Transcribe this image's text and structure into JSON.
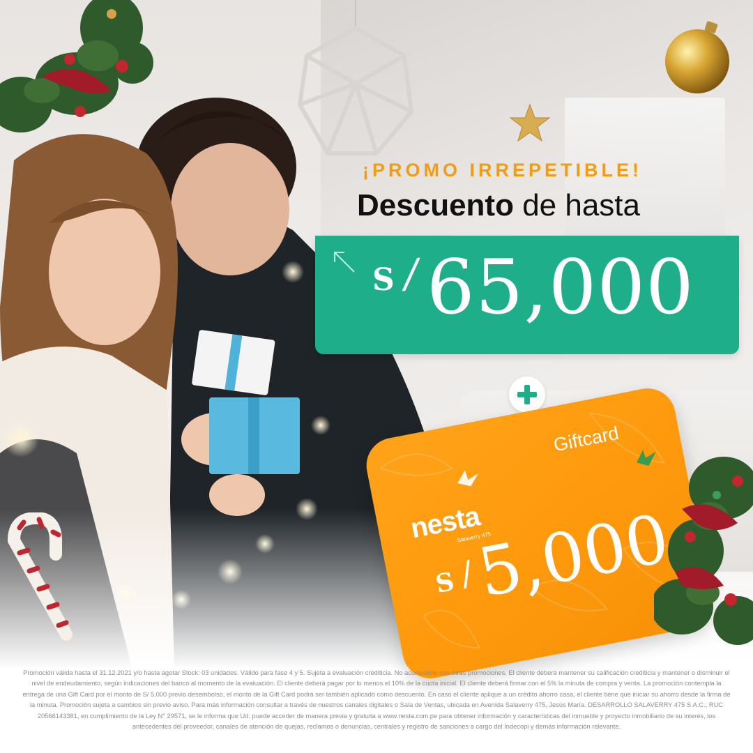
{
  "promo": {
    "kicker": "¡PROMO IRREPETIBLE!",
    "headline_strong": "Descuento",
    "headline_light": "de hasta"
  },
  "discount": {
    "currency": "S",
    "slash": "/",
    "amount": "65,000",
    "panel_color": "#1fae8a"
  },
  "plus_icon": "plus-icon",
  "giftcard": {
    "label": "Giftcard",
    "brand": "nesta",
    "brand_sub": "Salaverry 475",
    "currency": "S",
    "slash": "/",
    "amount": "5,000",
    "card_color": "#ff9a0d"
  },
  "legal": {
    "text": "Promoción válida hasta el 31.12.2021 y/o hasta agotar Stock: 03 unidades. Válido para fase 4 y 5. Sujeta a evaluación crediticia. No acumulable con otras promociones. El cliente deberá mantener su calificación crediticia y mantener o disminuir el nivel de endeudamiento, según indicaciones del banco al momento de la evaluación. El cliente deberá pagar por lo menos el 10% de la cuota inicial. El cliente deberá firmar con el 5% la minuta de compra y venta. La promoción contempla la entrega de una Gift Card por el monto de S/ 5,000 previo desembolso, el monto de la Gift Card podrá ser también aplicado como descuento. En caso el cliente aplique a un crédito ahorro casa, el cliente tiene que iniciar su ahorro desde la firma de la minuta. Promoción sujeta a cambios sin previo aviso. Para más información consultar a través de nuestros canales digitales o Sala de Ventas, ubicada en Avenida Salaverry 475, Jesús María. DESARROLLO SALAVERRY 475 S.A.C., RUC 20566143381, en cumplimiento de la Ley N° 29571, se le informa que Ud. puede acceder de manera previa y gratuita a www.nesta.com.pe para obtener información y características del inmueble y proyecto inmobiliario de su interés, los antecedentes del proveedor, canales de atención de quejas, reclamos o denuncias, centrales y registro de sanciones a cargo del Indecopi y demás información relevante."
  }
}
